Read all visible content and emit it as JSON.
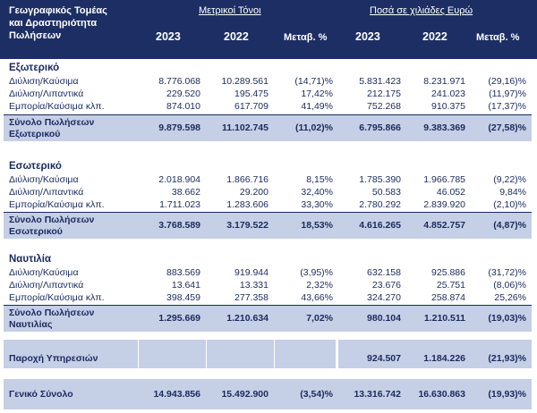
{
  "header": {
    "col_label": [
      "Γεωγραφικός Τομέας",
      "και Δραστηριότητα",
      "Πωλήσεων"
    ],
    "group_tons": "Μετρικοί Τόνοι",
    "group_eur": "Ποσά σε χιλιάδες Ευρώ",
    "year_a": "2023",
    "year_b": "2022",
    "change": "Μεταβ. %"
  },
  "sections": {
    "ext": {
      "title": "Εξωτερικό",
      "rows": [
        {
          "label": "Διύλιση/Καύσιμα",
          "v": [
            "8.776.068",
            "10.289.561",
            "(14,71)%",
            "5.831.423",
            "8.231.971",
            "(29,16)%"
          ]
        },
        {
          "label": "Διύλιση/Λιπαντικά",
          "v": [
            "229.520",
            "195.475",
            "17,42%",
            "212.175",
            "241.023",
            "(11,97)%"
          ]
        },
        {
          "label": "Εμπορία/Καύσιμα κλπ.",
          "v": [
            "874.010",
            "617.709",
            "41,49%",
            "752.268",
            "910.375",
            "(17,37)%"
          ]
        }
      ],
      "total_label": [
        "Σύνολο Πωλήσεων",
        "Εξωτερικού"
      ],
      "total": [
        "9.879.598",
        "11.102.745",
        "(11,02)%",
        "6.795.866",
        "9.383.369",
        "(27,58)%"
      ]
    },
    "dom": {
      "title": "Εσωτερικό",
      "rows": [
        {
          "label": "Διύλιση/Καύσιμα",
          "v": [
            "2.018.904",
            "1.866.716",
            "8,15%",
            "1.785.390",
            "1.966.785",
            "(9,22)%"
          ]
        },
        {
          "label": "Διύλιση/Λιπαντικά",
          "v": [
            "38.662",
            "29.200",
            "32,40%",
            "50.583",
            "46.052",
            "9,84%"
          ]
        },
        {
          "label": "Εμπορία/Καύσιμα κλπ.",
          "v": [
            "1.711.023",
            "1.283.606",
            "33,30%",
            "2.780.292",
            "2.839.920",
            "(2,10)%"
          ]
        }
      ],
      "total_label": [
        "Σύνολο Πωλήσεων",
        "Εσωτερικού"
      ],
      "total": [
        "3.768.589",
        "3.179.522",
        "18,53%",
        "4.616.265",
        "4.852.757",
        "(4,87)%"
      ]
    },
    "nav": {
      "title": "Ναυτιλία",
      "rows": [
        {
          "label": "Διύλιση/Καύσιμα",
          "v": [
            "883.569",
            "919.944",
            "(3,95)%",
            "632.158",
            "925.886",
            "(31,72)%"
          ]
        },
        {
          "label": "Διύλιση/Λιπαντικά",
          "v": [
            "13.641",
            "13.331",
            "2,32%",
            "23.676",
            "25.751",
            "(8,06)%"
          ]
        },
        {
          "label": "Εμπορία/Καύσιμα κλπ.",
          "v": [
            "398.459",
            "277.358",
            "43,66%",
            "324.270",
            "258.874",
            "25,26%"
          ]
        }
      ],
      "total_label": [
        "Σύνολο Πωλήσεων",
        "Ναυτιλίας"
      ],
      "total": [
        "1.295.669",
        "1.210.634",
        "7,02%",
        "980.104",
        "1.210.511",
        "(19,03)%"
      ]
    }
  },
  "services": {
    "label": "Παροχή Υπηρεσιών",
    "v": [
      "924.507",
      "1.184.226",
      "(21,93)%"
    ]
  },
  "grand_total": {
    "label": "Γενικό Σύνολο",
    "v": [
      "14.943.856",
      "15.492.900",
      "(3,54)%",
      "13.316.742",
      "16.630.863",
      "(19,93)%"
    ]
  },
  "colors": {
    "header_bg": "#1c2e64",
    "band_bg": "#c5cfe6",
    "text": "#1b2a5e"
  }
}
